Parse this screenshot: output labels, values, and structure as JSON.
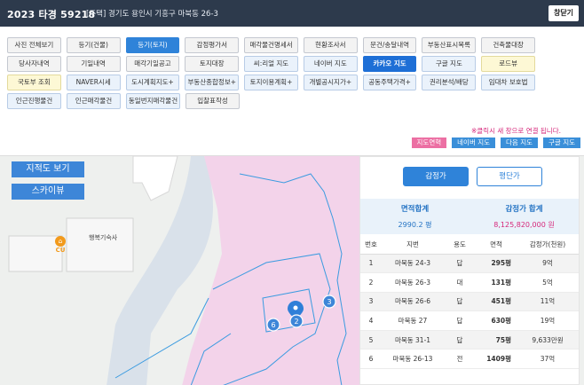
{
  "header": {
    "case_title": "2023 타경 59218",
    "address": "[주택] 경기도 용인시 기흥구 마북동 26-3",
    "close_label": "창닫기"
  },
  "buttons": {
    "row1": [
      "사진 전체보기",
      "등기(건물)",
      "등기(토지)",
      "감정평가서",
      "매각물건명세서",
      "현황조사서",
      "문건/송달내역",
      "부동산표시목록",
      "건축물대장"
    ],
    "row2": [
      "당사자내역",
      "기일내역",
      "매각기일공고",
      "토지대장",
      "씨:리얼 지도",
      "네이버 지도",
      "카카오 지도",
      "구글 지도",
      "로드뷰"
    ],
    "row3": [
      "국토부 조회",
      "NAVER시세",
      "도시계획지도+",
      "부동산종합정보+",
      "토지이용계획+",
      "개별공시지가+",
      "공동주택가격+",
      "권리분석/배당",
      "임대차 보호법"
    ],
    "row4": [
      "인근진행물건",
      "인근매각물건",
      "동일번지매각물건",
      "입찰표작성"
    ]
  },
  "notice": "※클릭시 새 창으로 연결 됩니다.",
  "map_links": [
    "지도연혁",
    "네이버 지도",
    "다음 지도",
    "구글 지도"
  ],
  "map": {
    "cadastral_button": "지적도 보기",
    "skyview_button": "스카이뷰",
    "poi_name": "행복기숙사",
    "poi_cu": "CU",
    "markers": [
      "2",
      "3",
      "6"
    ],
    "colors": {
      "parcel_fill": "#f3d3ea",
      "boundary": "#3b9be0",
      "marker": "#3d86d8"
    }
  },
  "panel": {
    "tabs": [
      "감정가",
      "평단가"
    ],
    "summary": {
      "area_label": "면적합계",
      "area_value": "2990.2 평",
      "price_label": "감정가 합계",
      "price_value": "8,125,820,000 원"
    },
    "columns": [
      "번호",
      "지번",
      "용도",
      "면적",
      "감정가(천원)"
    ],
    "rows": [
      {
        "no": "1",
        "lot": "마북동 24-3",
        "use": "답",
        "area": "295평",
        "price": "9억"
      },
      {
        "no": "2",
        "lot": "마북동 26-3",
        "use": "대",
        "area": "131평",
        "price": "5억"
      },
      {
        "no": "3",
        "lot": "마북동 26-6",
        "use": "답",
        "area": "451평",
        "price": "11억"
      },
      {
        "no": "4",
        "lot": "마북동 27",
        "use": "답",
        "area": "630평",
        "price": "19억"
      },
      {
        "no": "5",
        "lot": "마북동 31-1",
        "use": "답",
        "area": "75평",
        "price": "9,633만원"
      },
      {
        "no": "6",
        "lot": "마북동 26-13",
        "use": "전",
        "area": "1409평",
        "price": "37억"
      }
    ]
  }
}
